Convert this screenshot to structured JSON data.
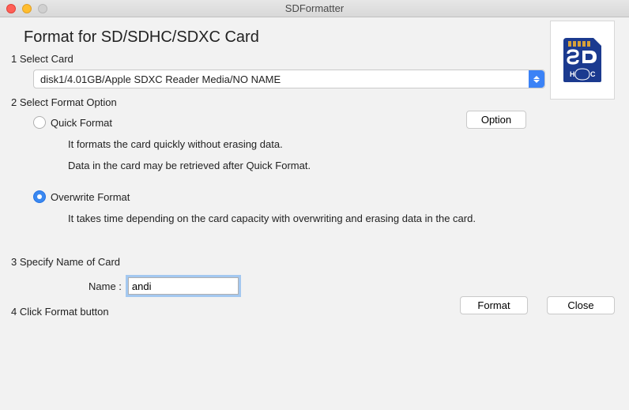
{
  "window": {
    "title": "SDFormatter"
  },
  "heading": "Format for SD/SDHC/SDXC Card",
  "steps": {
    "s1": "1 Select Card",
    "s2": "2 Select Format Option",
    "s3": "3 Specify Name of Card",
    "s4": "4 Click Format button"
  },
  "card_select": {
    "value": "disk1/4.01GB/Apple SDXC Reader Media/NO NAME"
  },
  "buttons": {
    "option": "Option",
    "format": "Format",
    "close": "Close"
  },
  "format_options": {
    "quick": {
      "label": "Quick Format",
      "help1": "It formats the card quickly without erasing data.",
      "help2": "Data in the card may be retrieved after Quick Format.",
      "selected": false
    },
    "overwrite": {
      "label": "Overwrite Format",
      "help1": "It takes time depending on the card capacity with overwriting and erasing data in the card.",
      "selected": true
    }
  },
  "name_field": {
    "label": "Name :",
    "value": "andi"
  },
  "logo": {
    "alt": "SDHC logo"
  }
}
